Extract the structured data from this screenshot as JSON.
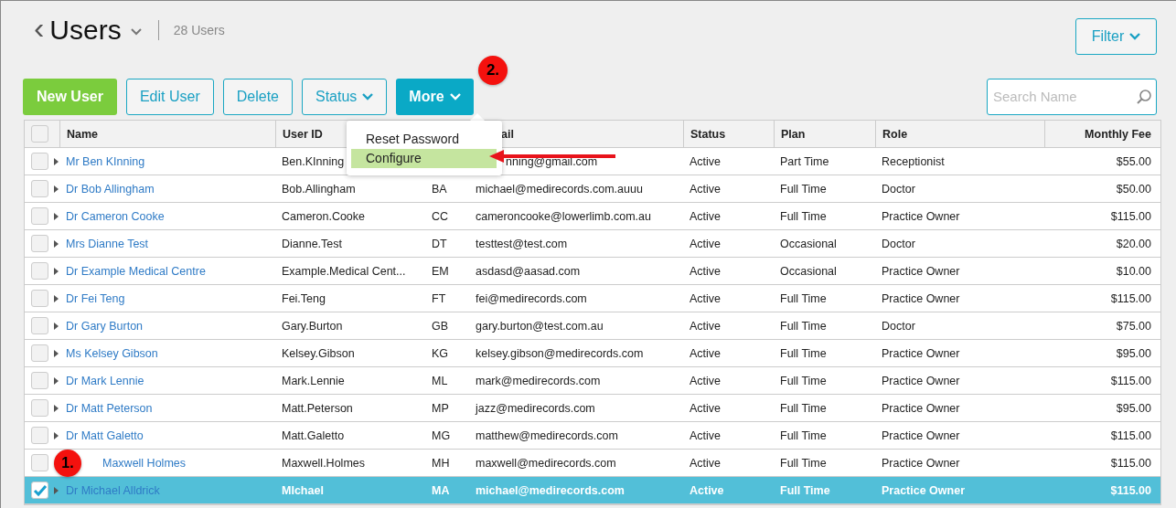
{
  "header": {
    "back": "‹",
    "title": "Users",
    "count": "28 Users"
  },
  "filter_button": "Filter",
  "toolbar": [
    {
      "label": "New User",
      "kind": "primary",
      "dropdown": false
    },
    {
      "label": "Edit User",
      "kind": "outline",
      "dropdown": false
    },
    {
      "label": "Delete",
      "kind": "outline",
      "dropdown": false
    },
    {
      "label": "Status",
      "kind": "outline",
      "dropdown": true
    },
    {
      "label": "More",
      "kind": "active",
      "dropdown": true
    }
  ],
  "search": {
    "placeholder": "Search Name"
  },
  "menu": {
    "open": true,
    "items": [
      {
        "label": "Reset Password",
        "selected": false
      },
      {
        "label": "Configure",
        "selected": true
      }
    ]
  },
  "annotations": [
    {
      "label": "2."
    }
  ],
  "table": {
    "all_checked": false,
    "columns": [
      "Name",
      "User ID",
      null,
      "ail",
      "Status",
      "Plan",
      "Role",
      "Monthly Fee"
    ],
    "rows": [
      {
        "name": "Mr Ben KInning",
        "user_id": "Ben.KInning",
        "email": "nning@gmail.com",
        "status": "Active",
        "plan": "Part Time",
        "role": "Receptionist",
        "fee": "$55.00",
        "checked": false,
        "selected": false
      },
      {
        "name": "Dr Bob Allingham",
        "user_id": "Bob.Allingham",
        "initials": "BA",
        "email": "michael@medirecords.com.auuu",
        "status": "Active",
        "plan": "Full Time",
        "role": "Doctor",
        "fee": "$50.00",
        "checked": false,
        "selected": false
      },
      {
        "name": "Dr Cameron Cooke",
        "user_id": "Cameron.Cooke",
        "initials": "CC",
        "email": "cameroncooke@lowerlimb.com.au",
        "status": "Active",
        "plan": "Full Time",
        "role": "Practice Owner",
        "fee": "$115.00",
        "checked": false,
        "selected": false
      },
      {
        "name": "Mrs Dianne Test",
        "user_id": "Dianne.Test",
        "initials": "DT",
        "email": "testtest@test.com",
        "status": "Active",
        "plan": "Occasional",
        "role": "Doctor",
        "fee": "$20.00",
        "checked": false,
        "selected": false
      },
      {
        "name": "Dr Example Medical Centre",
        "user_id": "Example.Medical Cent...",
        "initials": "EM",
        "email": "asdasd@aasad.com",
        "status": "Active",
        "plan": "Occasional",
        "role": "Practice Owner",
        "fee": "$10.00",
        "checked": false,
        "selected": false
      },
      {
        "name": "Dr Fei Teng",
        "user_id": "Fei.Teng",
        "initials": "FT",
        "email": "fei@medirecords.com",
        "status": "Active",
        "plan": "Full Time",
        "role": "Practice Owner",
        "fee": "$115.00",
        "checked": false,
        "selected": false
      },
      {
        "name": "Dr Gary Burton",
        "user_id": "Gary.Burton",
        "initials": "GB",
        "email": "gary.burton@test.com.au",
        "status": "Active",
        "plan": "Full Time",
        "role": "Doctor",
        "fee": "$75.00",
        "checked": false,
        "selected": false
      },
      {
        "name": "Ms Kelsey Gibson",
        "user_id": "Kelsey.Gibson",
        "initials": "KG",
        "email": "kelsey.gibson@medirecords.com",
        "status": "Active",
        "plan": "Full Time",
        "role": "Practice Owner",
        "fee": "$95.00",
        "checked": false,
        "selected": false
      },
      {
        "name": "Dr Mark Lennie",
        "user_id": "Mark.Lennie",
        "initials": "ML",
        "email": "mark@medirecords.com",
        "status": "Active",
        "plan": "Full Time",
        "role": "Practice Owner",
        "fee": "$115.00",
        "checked": false,
        "selected": false
      },
      {
        "name": "Dr Matt Peterson",
        "user_id": "Matt.Peterson",
        "initials": "MP",
        "email": "jazz@medirecords.com",
        "status": "Active",
        "plan": "Full Time",
        "role": "Practice Owner",
        "fee": "$95.00",
        "checked": false,
        "selected": false
      },
      {
        "name": "Dr Matt Galetto",
        "user_id": "Matt.Galetto",
        "initials": "MG",
        "email": "matthew@medirecords.com",
        "status": "Active",
        "plan": "Full Time",
        "role": "Practice Owner",
        "fee": "$115.00",
        "checked": false,
        "selected": false
      },
      {
        "name": "Maxwell Holmes",
        "user_id": "Maxwell.Holmes",
        "initials": "MH",
        "email": "maxwell@medirecords.com",
        "status": "Active",
        "plan": "Full Time",
        "role": "Practice Owner",
        "fee": "$115.00",
        "checked": false,
        "selected": false,
        "annotation": "1."
      },
      {
        "name": "Dr Michael Alldrick",
        "user_id": "MIchael",
        "initials": "MA",
        "email": "michael@medirecords.com",
        "status": "Active",
        "plan": "Full Time",
        "role": "Practice Owner",
        "fee": "$115.00",
        "checked": true,
        "selected": true
      }
    ]
  }
}
